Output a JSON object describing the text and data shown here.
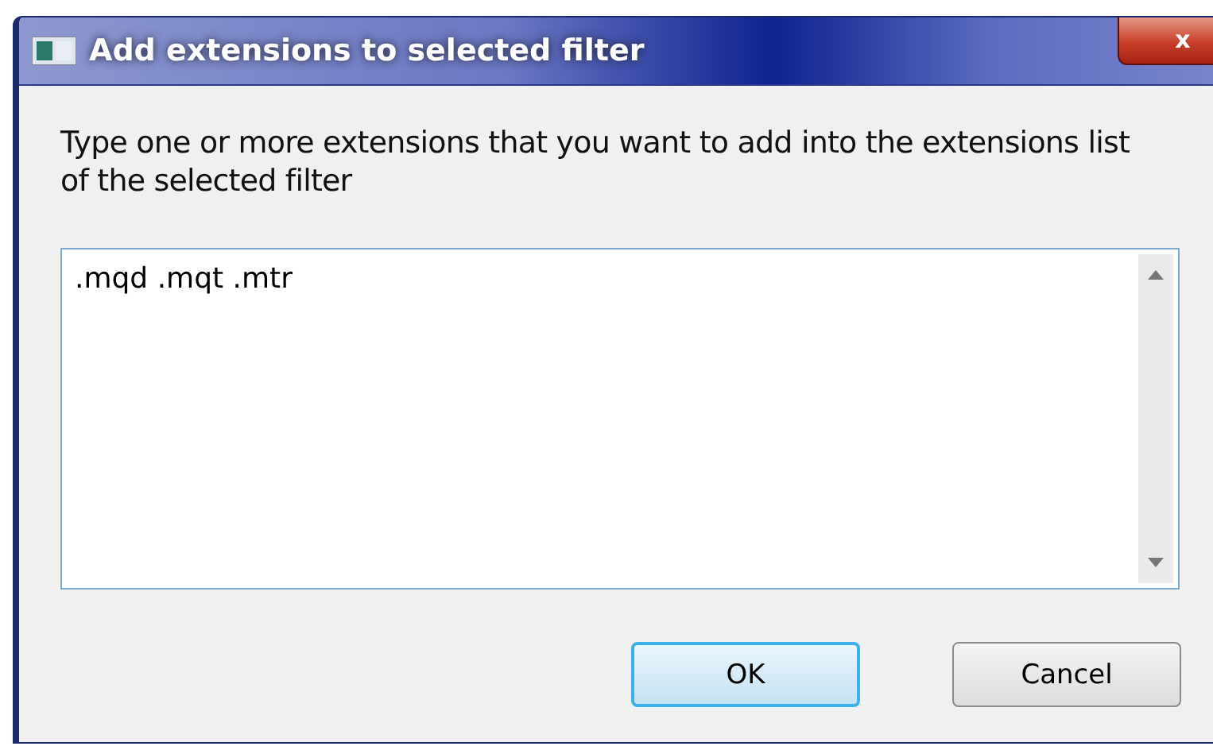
{
  "window": {
    "title": "Add extensions to selected filter",
    "close": "x"
  },
  "prompt": "Type one or more extensions that you want to add into the extensions list of the selected filter",
  "extensions_field": {
    "value": ".mqd .mqt .mtr"
  },
  "buttons": [
    {
      "label": "OK",
      "default": true
    },
    {
      "label": "Cancel",
      "default": false
    }
  ]
}
